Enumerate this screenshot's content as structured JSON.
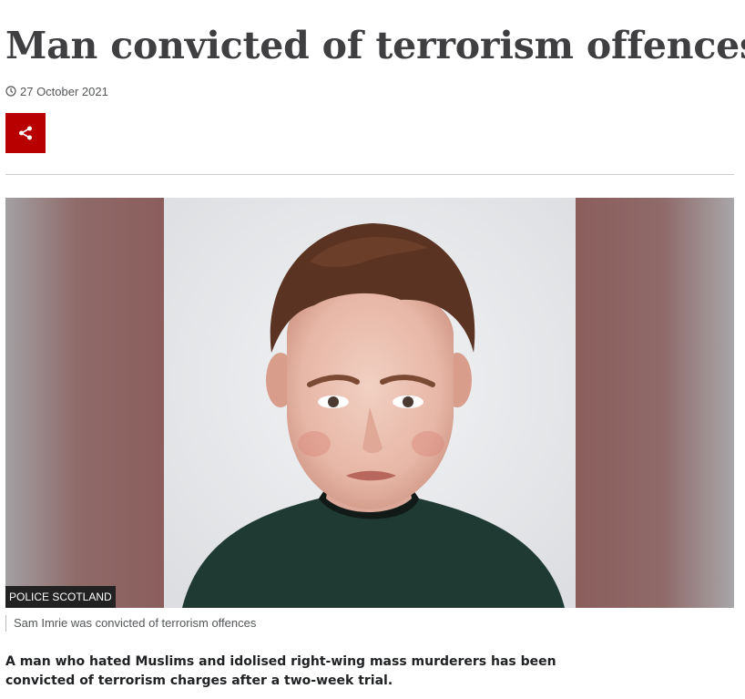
{
  "article": {
    "headline": "Man convicted of terrorism offences",
    "date": "27 October 2021",
    "share_icon": "share-icon",
    "clock_icon": "clock-icon",
    "image": {
      "credit": "POLICE SCOTLAND",
      "caption": "Sam Imrie was convicted of terrorism offences"
    },
    "intro": "A man who hated Muslims and idolised right-wing mass murderers has been convicted of terrorism charges after a two-week trial."
  },
  "colors": {
    "share_button": "#b80000",
    "headline": "#3f3f42",
    "divider": "#cccccc"
  }
}
